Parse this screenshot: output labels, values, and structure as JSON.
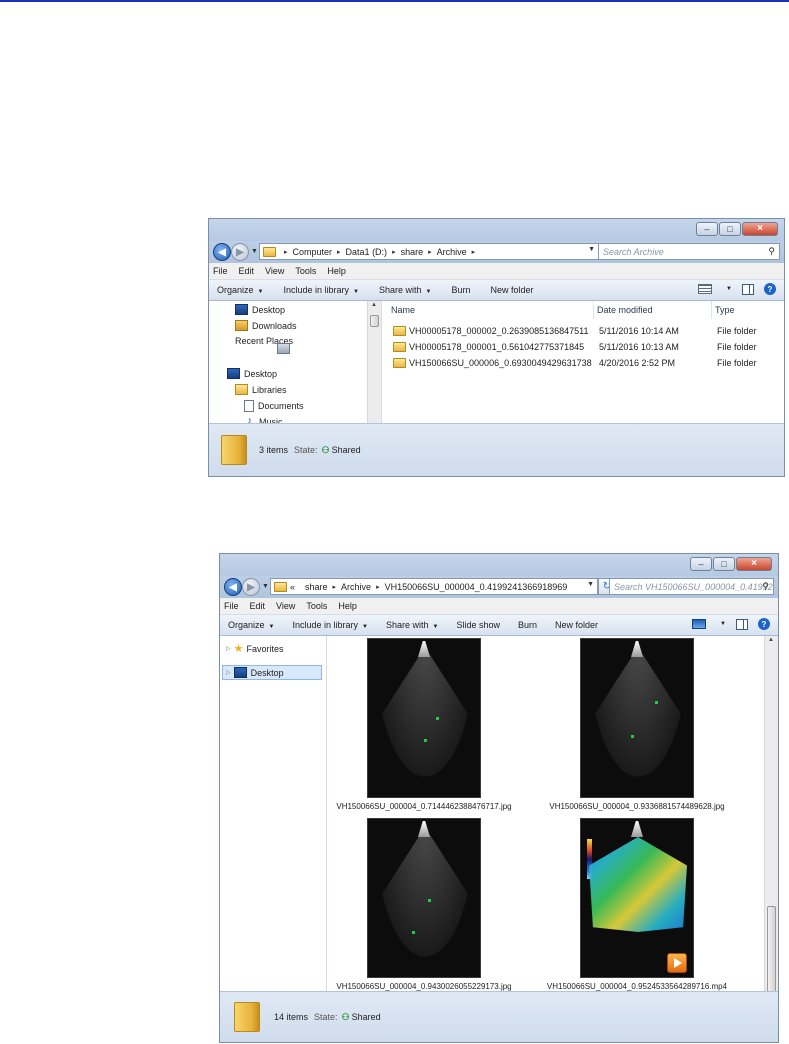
{
  "window1": {
    "menu": [
      "File",
      "Edit",
      "View",
      "Tools",
      "Help"
    ],
    "address": {
      "overflow": "",
      "crumbs": [
        "Computer",
        "Data1 (D:)",
        "share",
        "Archive"
      ]
    },
    "search_placeholder": "Search Archive",
    "toolbar": [
      "Organize",
      "Include in library",
      "Share with",
      "Burn",
      "New folder"
    ],
    "nav": [
      "Desktop",
      "Downloads",
      "Recent Places",
      "Desktop",
      "Libraries",
      "Documents",
      "Music"
    ],
    "columns": [
      "Name",
      "Date modified",
      "Type"
    ],
    "files": [
      {
        "name": "VH00005178_000002_0.2639085136847511",
        "date": "5/11/2016 10:14 AM",
        "type": "File folder"
      },
      {
        "name": "VH00005178_000001_0.561042775371845",
        "date": "5/11/2016 10:13 AM",
        "type": "File folder"
      },
      {
        "name": "VH150066SU_000006_0.6930049429631738",
        "date": "4/20/2016 2:52 PM",
        "type": "File folder"
      }
    ],
    "status": {
      "count": "3 items",
      "state_label": "State:",
      "state_value": "Shared"
    }
  },
  "window2": {
    "menu": [
      "File",
      "Edit",
      "View",
      "Tools",
      "Help"
    ],
    "address": {
      "overflow": "«",
      "crumbs": [
        "share",
        "Archive",
        "VH150066SU_000004_0.4199241366918969"
      ]
    },
    "search_placeholder": "Search VH150066SU_000004_0.419924...",
    "toolbar": [
      "Organize",
      "Include in library",
      "Share with",
      "Slide show",
      "Burn",
      "New folder"
    ],
    "nav": [
      "Favorites",
      "Desktop"
    ],
    "thumbs": [
      {
        "caption": "VH150066SU_000004_0.7144462388476717.jpg",
        "kind": "ultrasound"
      },
      {
        "caption": "VH150066SU_000004_0.9336881574489628.jpg",
        "kind": "ultrasound"
      },
      {
        "caption": "VH150066SU_000004_0.9430026055229173.jpg",
        "kind": "ultrasound"
      },
      {
        "caption": "VH150066SU_000004_0.9524533564289716.mp4",
        "kind": "video"
      }
    ],
    "status": {
      "count": "14 items",
      "state_label": "State:",
      "state_value": "Shared"
    }
  }
}
